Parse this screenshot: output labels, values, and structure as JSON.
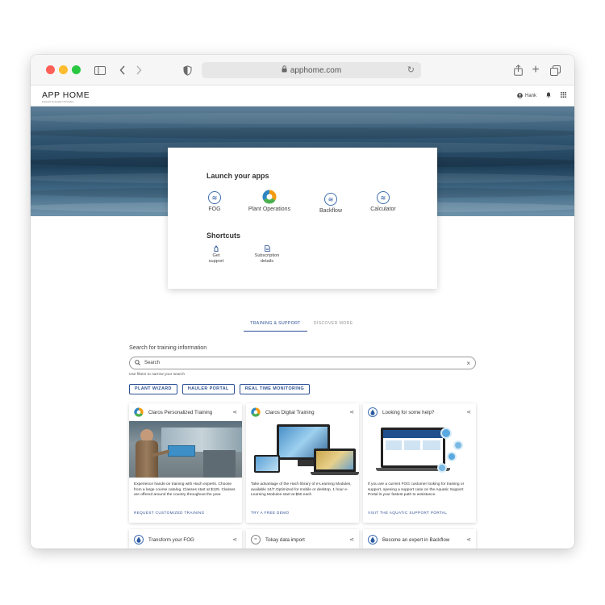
{
  "browser": {
    "url": "apphome.com"
  },
  "header": {
    "logo_title": "APP HOME",
    "logo_subtitle": "Powered by Aquatic Informatics",
    "user_name": "Hank"
  },
  "launch": {
    "title": "Launch your apps",
    "apps": [
      {
        "label": "FOG"
      },
      {
        "label": "Plant Operations"
      },
      {
        "label": "Backflow"
      },
      {
        "label": "Calculator"
      }
    ],
    "shortcuts_title": "Shortcuts",
    "shortcuts": [
      {
        "line1": "Get",
        "line2": "support"
      },
      {
        "line1": "Subscription",
        "line2": "details"
      }
    ]
  },
  "tabs": [
    {
      "label": "TRAINING & SUPPORT",
      "active": true
    },
    {
      "label": "DISCOVER MORE",
      "active": false
    }
  ],
  "search": {
    "title": "Search for training information",
    "placeholder": "Search",
    "hint": "Use filters to narrow your search"
  },
  "filters": [
    "PLANT WIZARD",
    "HAULER PORTAL",
    "REAL TIME MONITORING"
  ],
  "cards": [
    {
      "title": "Claros Personalized Training",
      "text": "Experience hands-on training with Hach experts. Choose from a large course catalog. Classes start at $125. Classes are offered around the country throughout the year.",
      "link": "REQUEST CUSTOMIZED TRAINING"
    },
    {
      "title": "Claros Digital Training",
      "text": "Take advantage of the Hach library of e-Learning Modules, available 24/7.Optimized for mobile or desktop. 1 hour e-Learning Modules start at $50 each",
      "link": "TRY A FREE DEMO"
    },
    {
      "title": "Looking for some help?",
      "text": "If you are a current FOG customer looking for training or support, opening a support case on the Aquatic Support Portal is your fastest path to assistance.",
      "link": "VISIT THE AQUATIC SUPPORT PORTAL"
    }
  ],
  "mini_cards": [
    {
      "title": "Transform your FOG"
    },
    {
      "title": "Tokay data import"
    },
    {
      "title": "Become an expert in Backflow"
    }
  ],
  "colors": {
    "accent": "#2c4f94",
    "traffic_red": "#fe5f57",
    "traffic_yellow": "#febc2e",
    "traffic_green": "#28c840"
  }
}
